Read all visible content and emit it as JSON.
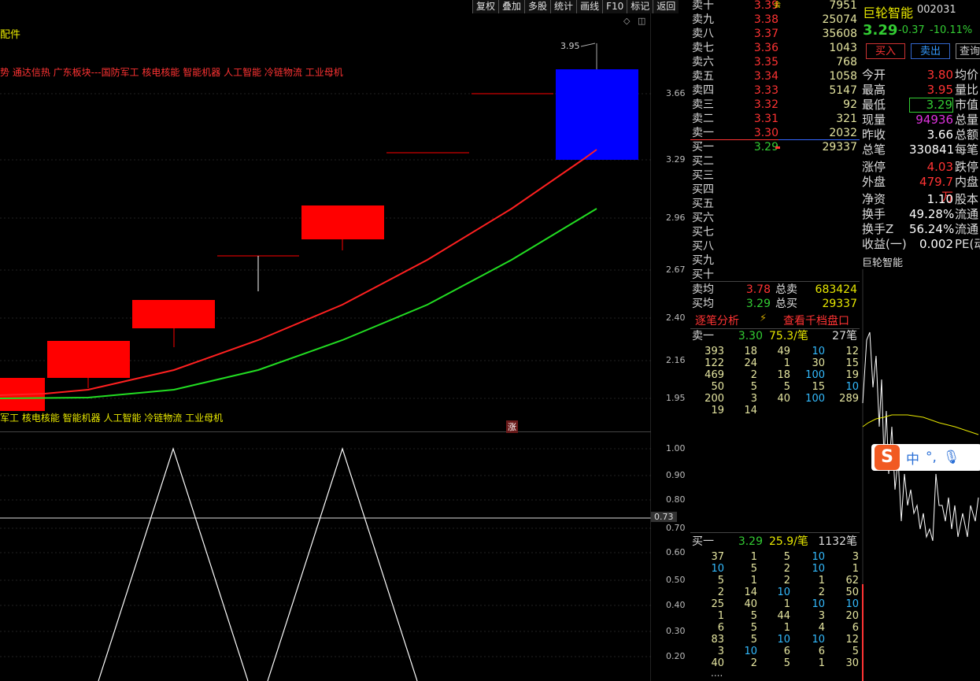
{
  "toolbar": [
    "复权",
    "叠加",
    "多股",
    "统计",
    "画线",
    "F10",
    "标记",
    "返回"
  ],
  "main_chart": {
    "config_label": "配件",
    "concepts_top": "势 通达信热 广东板块---国防军工 核电核能 智能机器 人工智能 冷链物流 工业母机",
    "concepts_bottom": "军工 核电核能 智能机器 人工智能 冷链物流 工业母机",
    "high_marker": "3.95",
    "zhang_badge": "涨",
    "y_ticks": [
      "3.66",
      "3.29",
      "2.96",
      "2.67",
      "2.40",
      "2.16",
      "1.95"
    ]
  },
  "sub_chart": {
    "y_ticks": [
      "1.00",
      "0.90",
      "0.80",
      "0.70",
      "0.60",
      "0.50",
      "0.40",
      "0.30",
      "0.20"
    ],
    "current_value": "0.73"
  },
  "orderbook": {
    "sells": [
      {
        "label": "卖十",
        "price": "3.39",
        "vol": "7951",
        "tag": "会"
      },
      {
        "label": "卖九",
        "price": "3.38",
        "vol": "25074"
      },
      {
        "label": "卖八",
        "price": "3.37",
        "vol": "35608"
      },
      {
        "label": "卖七",
        "price": "3.36",
        "vol": "1043"
      },
      {
        "label": "卖六",
        "price": "3.35",
        "vol": "768"
      },
      {
        "label": "卖五",
        "price": "3.34",
        "vol": "1058"
      },
      {
        "label": "卖四",
        "price": "3.33",
        "vol": "5147"
      },
      {
        "label": "卖三",
        "price": "3.32",
        "vol": "92"
      },
      {
        "label": "卖二",
        "price": "3.31",
        "vol": "321"
      },
      {
        "label": "卖一",
        "price": "3.30",
        "vol": "2032"
      }
    ],
    "buys": [
      {
        "label": "买一",
        "price": "3.29",
        "vol": "29337"
      },
      {
        "label": "买二",
        "price": "",
        "vol": ""
      },
      {
        "label": "买三",
        "price": "",
        "vol": ""
      },
      {
        "label": "买四",
        "price": "",
        "vol": ""
      },
      {
        "label": "买五",
        "price": "",
        "vol": ""
      },
      {
        "label": "买六",
        "price": "",
        "vol": ""
      },
      {
        "label": "买七",
        "price": "",
        "vol": ""
      },
      {
        "label": "买八",
        "price": "",
        "vol": ""
      },
      {
        "label": "买九",
        "price": "",
        "vol": ""
      },
      {
        "label": "买十",
        "price": "",
        "vol": ""
      }
    ],
    "sell_avg_label": "卖均",
    "sell_avg": "3.78",
    "sell_total_label": "总卖",
    "sell_total": "683424",
    "buy_avg_label": "买均",
    "buy_avg": "3.29",
    "buy_total_label": "总买",
    "buy_total": "29337",
    "tab_tick": "逐笔分析",
    "tab_depth": "查看千档盘口",
    "sell1_line": {
      "label": "卖一",
      "price": "3.30",
      "per": "75.3/笔",
      "count": "27笔"
    },
    "sell1_grid": [
      [
        "393",
        "18",
        "49",
        "10",
        "12"
      ],
      [
        "122",
        "24",
        "1",
        "30",
        "15"
      ],
      [
        "469",
        "2",
        "18",
        "100",
        "19"
      ],
      [
        "50",
        "5",
        "5",
        "15",
        "10"
      ],
      [
        "200",
        "3",
        "40",
        "100",
        "289"
      ],
      [
        "19",
        "14",
        "",
        "",
        ""
      ]
    ],
    "buy1_line": {
      "label": "买一",
      "price": "3.29",
      "per": "25.9/笔",
      "count": "1132笔"
    },
    "buy1_grid": [
      [
        "37",
        "1",
        "5",
        "10",
        "3"
      ],
      [
        "10",
        "5",
        "2",
        "10",
        "1"
      ],
      [
        "5",
        "1",
        "2",
        "1",
        "62"
      ],
      [
        "2",
        "14",
        "10",
        "2",
        "50"
      ],
      [
        "25",
        "40",
        "1",
        "10",
        "10"
      ],
      [
        "1",
        "5",
        "44",
        "3",
        "20"
      ],
      [
        "6",
        "5",
        "1",
        "4",
        "6"
      ],
      [
        "83",
        "5",
        "10",
        "10",
        "12"
      ],
      [
        "3",
        "10",
        "6",
        "6",
        "5"
      ],
      [
        "40",
        "2",
        "5",
        "1",
        "30"
      ]
    ],
    "more": "...."
  },
  "info": {
    "name": "巨轮智能",
    "code": "002031",
    "price": "3.29",
    "change": "-0.37",
    "pct": "-10.11%",
    "buy_btn": "买入",
    "sell_btn": "卖出",
    "query_btn": "查询",
    "rows": [
      {
        "k": "今开",
        "v": "3.80",
        "k2": "均价"
      },
      {
        "k": "最高",
        "v": "3.95",
        "k2": "量比"
      },
      {
        "k": "最低",
        "v": "3.29",
        "k2": "市值"
      },
      {
        "k": "现量",
        "v": "94936",
        "k2": "总量"
      },
      {
        "k": "昨收",
        "v": "3.66",
        "k2": "总额"
      },
      {
        "k": "总笔",
        "v": "330841",
        "k2": "每笔"
      },
      {
        "k": "涨停",
        "v": "4.03",
        "k2": "跌停"
      },
      {
        "k": "外盘",
        "v": "479.7万",
        "k2": "内盘"
      },
      {
        "k": "净资",
        "v": "1.10",
        "k2": "股本"
      },
      {
        "k": "换手",
        "v": "49.28%",
        "k2": "流通"
      },
      {
        "k": "换手Z",
        "v": "56.24%",
        "k2": "流通"
      },
      {
        "k": "收益(一)",
        "v": "0.002",
        "k2": "PE(动"
      }
    ],
    "footer_name": "巨轮智能",
    "ime": "中"
  },
  "colors": {
    "up": "#ff0000",
    "down": "#0000ff",
    "ma_red": "#ff2020",
    "ma_green": "#22dd22"
  }
}
